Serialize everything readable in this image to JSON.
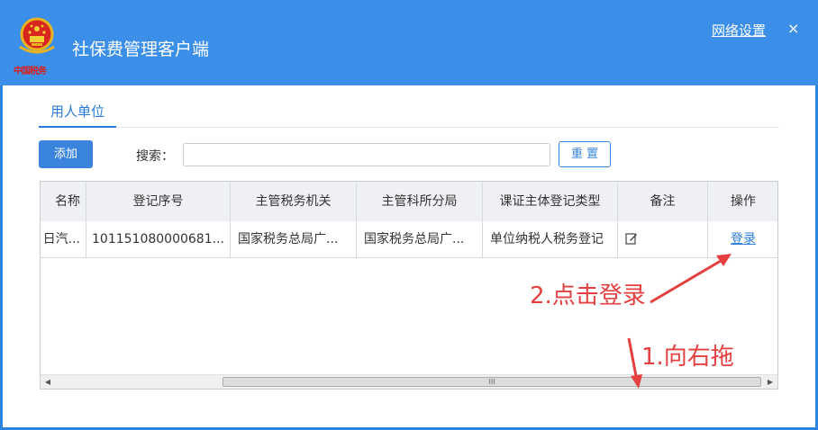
{
  "window": {
    "title": "社保费管理客户端",
    "emblem_caption": "中国税务",
    "network_settings": "网络设置",
    "close": "×"
  },
  "tabs": [
    {
      "label": "用人单位",
      "active": true
    }
  ],
  "toolbar": {
    "add_label": "添加",
    "search_label": "搜索：",
    "search_value": "",
    "search_placeholder": "",
    "reset_label": "重 置"
  },
  "table": {
    "columns": [
      "名称",
      "登记序号",
      "主管税务机关",
      "主管科所分局",
      "课证主体登记类型",
      "备注",
      "操作"
    ],
    "rows": [
      {
        "name": "日汽...",
        "reg_no": "101151080000681...",
        "tax_authority": "国家税务总局广...",
        "branch": "国家税务总局广...",
        "reg_type": "单位纳税人税务登记",
        "remark_icon": "edit-icon",
        "action": "登录"
      }
    ]
  },
  "scrollbar": {
    "grip": "III"
  },
  "annotations": {
    "step1": "1.向右拖",
    "step2": "2.点击登录",
    "color": "#e53f3f"
  }
}
